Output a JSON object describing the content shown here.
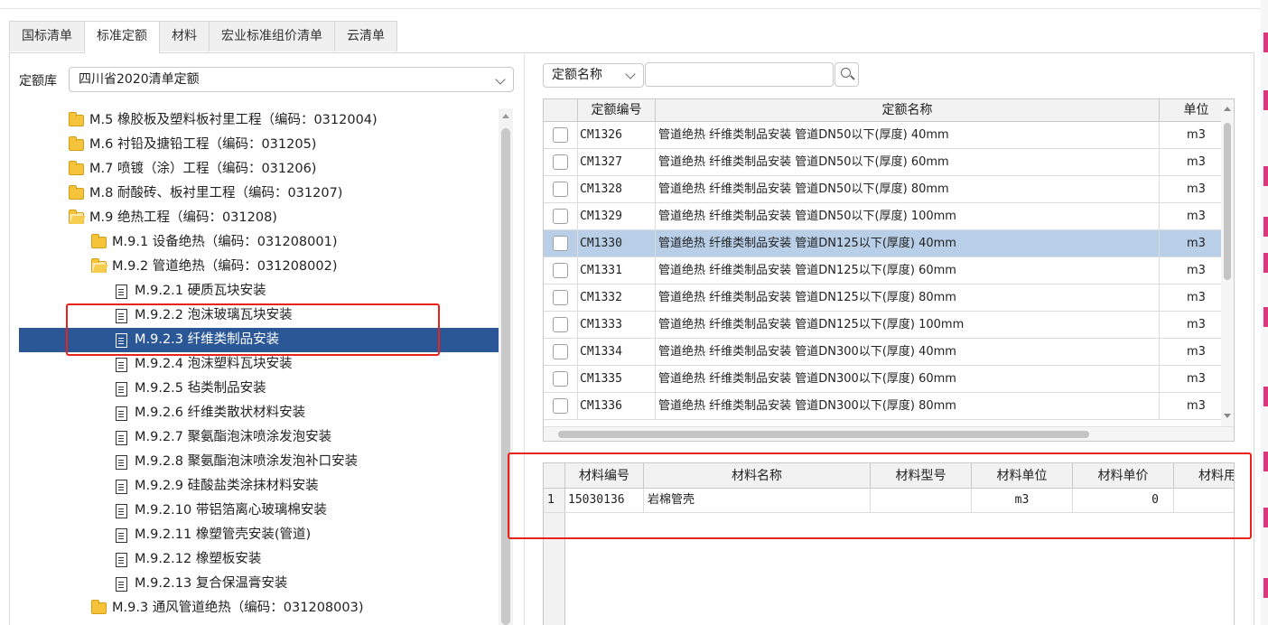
{
  "tabs": [
    {
      "label": "国标清单",
      "active": false
    },
    {
      "label": "标准定额",
      "active": true
    },
    {
      "label": "材料",
      "active": false
    },
    {
      "label": "宏业标准组价清单",
      "active": false
    },
    {
      "label": "云清单",
      "active": false
    }
  ],
  "library": {
    "label": "定额库",
    "value": "四川省2020清单定额"
  },
  "tree": [
    {
      "text": "M.5 橡胶板及塑料板衬里工程（编码：0312004)",
      "icon": "folder-icon"
    },
    {
      "text": "M.6 衬铅及搪铅工程（编码：031205)",
      "icon": "folder-icon"
    },
    {
      "text": "M.7 喷镀（涂）工程（编码：031206)",
      "icon": "folder-icon"
    },
    {
      "text": "M.8 耐酸砖、板衬里工程（编码：031207)",
      "icon": "folder-icon"
    },
    {
      "text": "M.9 绝热工程（编码：031208)",
      "icon": "folder-open-icon"
    },
    {
      "text": "M.9.1 设备绝热（编码：031208001)",
      "icon": "folder-icon"
    },
    {
      "text": "M.9.2 管道绝热（编码：031208002)",
      "icon": "folder-open-icon"
    },
    {
      "text": "M.9.2.1 硬质瓦块安装",
      "icon": "document-icon"
    },
    {
      "text": "M.9.2.2 泡沫玻璃瓦块安装",
      "icon": "document-icon"
    },
    {
      "text": "M.9.2.3 纤维类制品安装",
      "icon": "document-icon",
      "selected": true
    },
    {
      "text": "M.9.2.4 泡沫塑料瓦块安装",
      "icon": "document-icon"
    },
    {
      "text": "M.9.2.5 毡类制品安装",
      "icon": "document-icon"
    },
    {
      "text": "M.9.2.6 纤维类散状材料安装",
      "icon": "document-icon"
    },
    {
      "text": "M.9.2.7 聚氨酯泡沫喷涂发泡安装",
      "icon": "document-icon"
    },
    {
      "text": "M.9.2.8 聚氨酯泡沫喷涂发泡补口安装",
      "icon": "document-icon"
    },
    {
      "text": "M.9.2.9 硅酸盐类涂抹材料安装",
      "icon": "document-icon"
    },
    {
      "text": "M.9.2.10 带铝箔离心玻璃棉安装",
      "icon": "document-icon"
    },
    {
      "text": "M.9.2.11 橡塑管壳安装(管道)",
      "icon": "document-icon"
    },
    {
      "text": "M.9.2.12 橡塑板安装",
      "icon": "document-icon"
    },
    {
      "text": "M.9.2.13 复合保温膏安装",
      "icon": "document-icon"
    },
    {
      "text": "M.9.3 通风管道绝热（编码：031208003)",
      "icon": "folder-icon"
    }
  ],
  "search": {
    "filter_field": "定额名称",
    "query": ""
  },
  "quota_table": {
    "headers": [
      "定额编号",
      "定额名称",
      "单位"
    ],
    "rows": [
      {
        "code": "CM1326",
        "name": "管道绝热 纤维类制品安装 管道DN50以下(厚度) 40mm",
        "unit": "m3"
      },
      {
        "code": "CM1327",
        "name": "管道绝热 纤维类制品安装 管道DN50以下(厚度) 60mm",
        "unit": "m3"
      },
      {
        "code": "CM1328",
        "name": "管道绝热 纤维类制品安装 管道DN50以下(厚度) 80mm",
        "unit": "m3"
      },
      {
        "code": "CM1329",
        "name": "管道绝热 纤维类制品安装 管道DN50以下(厚度) 100mm",
        "unit": "m3"
      },
      {
        "code": "CM1330",
        "name": "管道绝热 纤维类制品安装 管道DN125以下(厚度) 40mm",
        "unit": "m3",
        "selected": true
      },
      {
        "code": "CM1331",
        "name": "管道绝热 纤维类制品安装 管道DN125以下(厚度) 60mm",
        "unit": "m3"
      },
      {
        "code": "CM1332",
        "name": "管道绝热 纤维类制品安装 管道DN125以下(厚度) 80mm",
        "unit": "m3"
      },
      {
        "code": "CM1333",
        "name": "管道绝热 纤维类制品安装 管道DN125以下(厚度) 100mm",
        "unit": "m3"
      },
      {
        "code": "CM1334",
        "name": "管道绝热 纤维类制品安装 管道DN300以下(厚度) 40mm",
        "unit": "m3"
      },
      {
        "code": "CM1335",
        "name": "管道绝热 纤维类制品安装 管道DN300以下(厚度) 60mm",
        "unit": "m3"
      },
      {
        "code": "CM1336",
        "name": "管道绝热 纤维类制品安装 管道DN300以下(厚度) 80mm",
        "unit": "m3"
      }
    ]
  },
  "material_table": {
    "headers": [
      "材料编号",
      "材料名称",
      "材料型号",
      "材料单位",
      "材料单价",
      "材料用"
    ],
    "rows": [
      {
        "index": "1",
        "code": "15030136",
        "name": "岩棉管壳",
        "model": "",
        "unit": "m3",
        "price": "0",
        "usage": ""
      }
    ]
  },
  "colors": {
    "selection": "#2b5797",
    "row_highlight": "#b9cfe8",
    "annotation": "#e8231b"
  }
}
